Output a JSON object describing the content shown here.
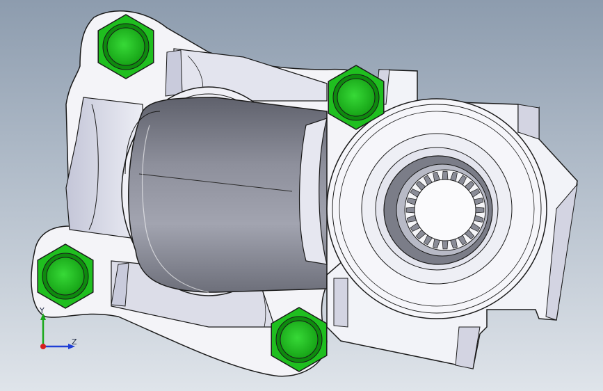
{
  "viewport": {
    "background_top": "#8d9cae",
    "background_bottom": "#dfe4ea"
  },
  "part": {
    "body_color": "#f4f4f8",
    "edge_color": "#1a1a1a",
    "shade_color": "#c9cbdc",
    "cylinder_color": "#7d7f8c",
    "bolt_color": "#1fbf1f",
    "bolt_dark": "#0e8a0e"
  },
  "triad": {
    "y_label": "Y",
    "z_label": "Z",
    "y_color": "#1aa81a",
    "z_color": "#1f3fd6",
    "x_color": "#d61f1f"
  }
}
